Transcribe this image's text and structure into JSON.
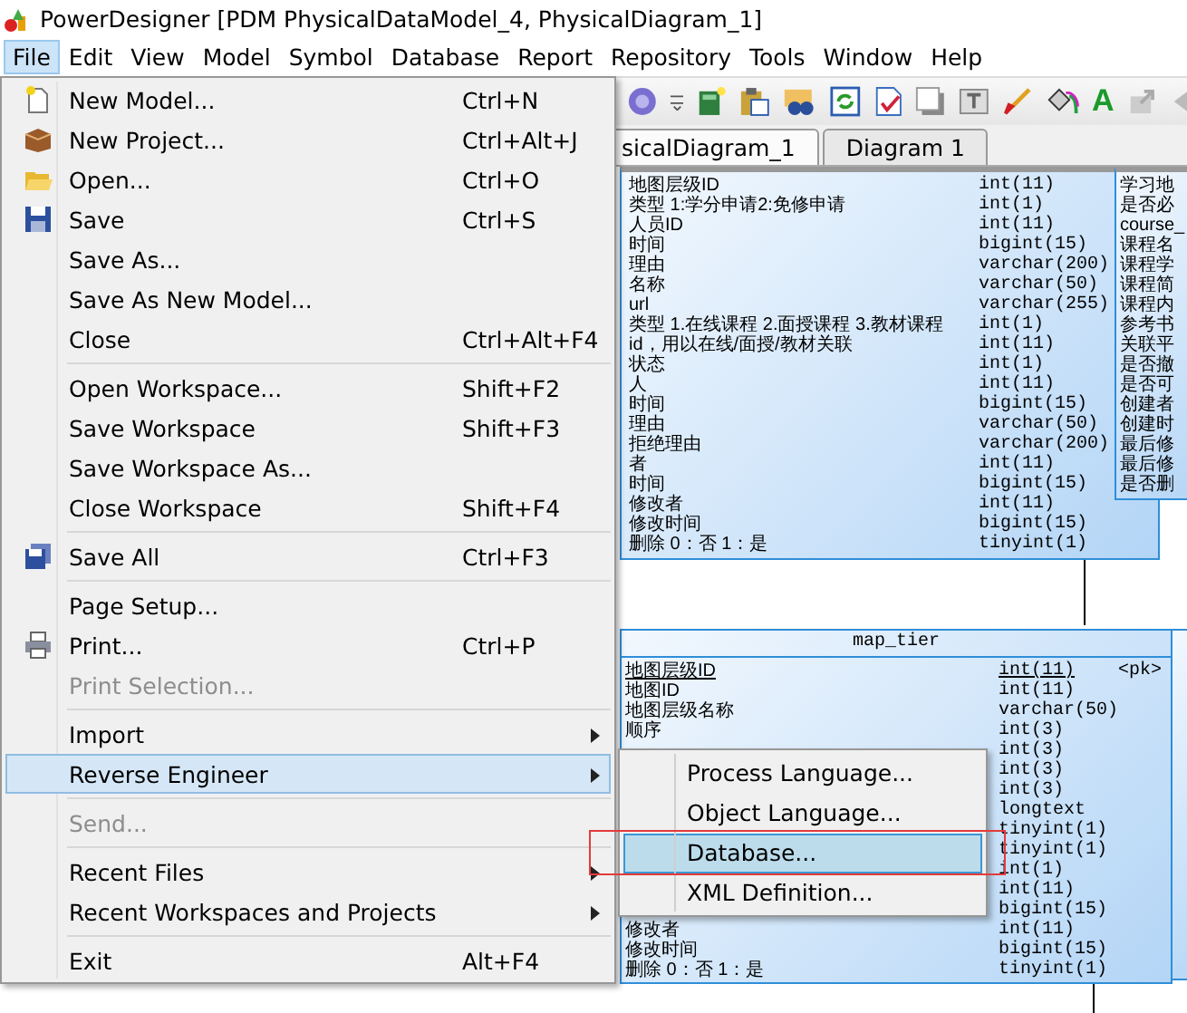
{
  "window": {
    "title": "PowerDesigner [PDM PhysicalDataModel_4, PhysicalDiagram_1]"
  },
  "menubar": [
    {
      "label": "File",
      "selected": true
    },
    {
      "label": "Edit",
      "selected": false
    },
    {
      "label": "View",
      "selected": false
    },
    {
      "label": "Model",
      "selected": false
    },
    {
      "label": "Symbol",
      "selected": false
    },
    {
      "label": "Database",
      "selected": false
    },
    {
      "label": "Report",
      "selected": false
    },
    {
      "label": "Repository",
      "selected": false
    },
    {
      "label": "Tools",
      "selected": false
    },
    {
      "label": "Window",
      "selected": false
    },
    {
      "label": "Help",
      "selected": false
    }
  ],
  "toolbar": {
    "glyph": "A"
  },
  "diagram_tabs": [
    {
      "label": "sicalDiagram_1",
      "selected": true
    },
    {
      "label": "Diagram 1",
      "selected": false
    }
  ],
  "upper_table": {
    "rows": [
      {
        "name": "地图层级ID",
        "type": "int(11)"
      },
      {
        "name": "类型 1:学分申请2:免修申请",
        "type": "int(1)"
      },
      {
        "name": "人员ID",
        "type": "int(11)"
      },
      {
        "name": "时间",
        "type": "bigint(15)"
      },
      {
        "name": "理由",
        "type": "varchar(200)"
      },
      {
        "name": "名称",
        "type": "varchar(50)"
      },
      {
        "name": "url",
        "type": "varchar(255)"
      },
      {
        "name": "类型 1.在线课程 2.面授课程 3.教材课程",
        "type": "int(1)"
      },
      {
        "name": "id，用以在线/面授/教材关联",
        "type": "int(11)"
      },
      {
        "name": "状态",
        "type": "int(1)"
      },
      {
        "name": "人",
        "type": "int(11)"
      },
      {
        "name": "时间",
        "type": "bigint(15)"
      },
      {
        "name": "理由",
        "type": "varchar(50)"
      },
      {
        "name": "拒绝理由",
        "type": "varchar(200)"
      },
      {
        "name": "者",
        "type": "int(11)"
      },
      {
        "name": "时间",
        "type": "bigint(15)"
      },
      {
        "name": "修改者",
        "type": "int(11)"
      },
      {
        "name": "修改时间",
        "type": "bigint(15)"
      },
      {
        "name": "删除 0：否 1：是",
        "type": "tinyint(1)"
      }
    ]
  },
  "side_table": {
    "rows": [
      "学习地",
      "是否必",
      "course_",
      "课程名",
      "课程学",
      "课程简",
      "课程内",
      "参考书",
      "关联平",
      "是否撤",
      "是否可",
      "创建者",
      "创建时",
      "最后修",
      "最后修",
      "是否删"
    ]
  },
  "map_tier_table": {
    "title": "map_tier",
    "rows": [
      {
        "name": "地图层级ID",
        "type": "int(11)",
        "key": "<pk>"
      },
      {
        "name": "地图ID",
        "type": "int(11)"
      },
      {
        "name": "地图层级名称",
        "type": "varchar(50)"
      },
      {
        "name": "顺序",
        "type": "int(3)"
      },
      {
        "type": "int(3)"
      },
      {
        "type": "int(3)"
      },
      {
        "type": "int(3)"
      },
      {
        "type": "longtext"
      },
      {
        "type": "tinyint(1)"
      },
      {
        "type": "tinyint(1)"
      },
      {
        "type": "int(1)"
      },
      {
        "type": "int(11)"
      },
      {
        "type": "bigint(15)"
      },
      {
        "name": "修改者",
        "type": "int(11)"
      },
      {
        "name": "修改时间",
        "type": "bigint(15)"
      },
      {
        "name": "删除 0：否 1：是",
        "type": "tinyint(1)"
      }
    ]
  },
  "file_menu": {
    "items": [
      {
        "kind": "item",
        "label": "New Model...",
        "shortcut": "Ctrl+N",
        "submenu": false,
        "disabled": false,
        "selected": false
      },
      {
        "kind": "item",
        "label": "New Project...",
        "shortcut": "Ctrl+Alt+J",
        "submenu": false,
        "disabled": false,
        "selected": false
      },
      {
        "kind": "item",
        "label": "Open...",
        "shortcut": "Ctrl+O",
        "submenu": false,
        "disabled": false,
        "selected": false
      },
      {
        "kind": "item",
        "label": "Save",
        "shortcut": "Ctrl+S",
        "submenu": false,
        "disabled": false,
        "selected": false
      },
      {
        "kind": "item",
        "label": "Save As...",
        "submenu": false,
        "disabled": false,
        "selected": false
      },
      {
        "kind": "item",
        "label": "Save As New Model...",
        "submenu": false,
        "disabled": false,
        "selected": false
      },
      {
        "kind": "item",
        "label": "Close",
        "shortcut": "Ctrl+Alt+F4",
        "submenu": false,
        "disabled": false,
        "selected": false
      },
      {
        "kind": "separator"
      },
      {
        "kind": "item",
        "label": "Open Workspace...",
        "shortcut": "Shift+F2",
        "submenu": false,
        "disabled": false,
        "selected": false
      },
      {
        "kind": "item",
        "label": "Save Workspace",
        "shortcut": "Shift+F3",
        "submenu": false,
        "disabled": false,
        "selected": false
      },
      {
        "kind": "item",
        "label": "Save Workspace As...",
        "submenu": false,
        "disabled": false,
        "selected": false
      },
      {
        "kind": "item",
        "label": "Close Workspace",
        "shortcut": "Shift+F4",
        "submenu": false,
        "disabled": false,
        "selected": false
      },
      {
        "kind": "separator"
      },
      {
        "kind": "item",
        "label": "Save All",
        "shortcut": "Ctrl+F3",
        "submenu": false,
        "disabled": false,
        "selected": false
      },
      {
        "kind": "separator"
      },
      {
        "kind": "item",
        "label": "Page Setup...",
        "submenu": false,
        "disabled": false,
        "selected": false
      },
      {
        "kind": "item",
        "label": "Print...",
        "shortcut": "Ctrl+P",
        "submenu": false,
        "disabled": false,
        "selected": false
      },
      {
        "kind": "item",
        "label": "Print Selection...",
        "submenu": false,
        "disabled": true,
        "selected": false
      },
      {
        "kind": "separator"
      },
      {
        "kind": "item",
        "label": "Import",
        "submenu": true,
        "disabled": false,
        "selected": false
      },
      {
        "kind": "item",
        "label": "Reverse Engineer",
        "submenu": true,
        "disabled": false,
        "selected": true
      },
      {
        "kind": "separator"
      },
      {
        "kind": "item",
        "label": "Send...",
        "submenu": false,
        "disabled": true,
        "selected": false
      },
      {
        "kind": "separator"
      },
      {
        "kind": "item",
        "label": "Recent Files",
        "submenu": true,
        "disabled": false,
        "selected": false
      },
      {
        "kind": "item",
        "label": "Recent Workspaces and Projects",
        "submenu": true,
        "disabled": false,
        "selected": false
      },
      {
        "kind": "separator"
      },
      {
        "kind": "item",
        "label": "Exit",
        "shortcut": "Alt+F4",
        "submenu": false,
        "disabled": false,
        "selected": false
      }
    ]
  },
  "reverse_engineer_submenu": {
    "items": [
      {
        "label": "Process Language...",
        "selected": false
      },
      {
        "label": "Object Language...",
        "selected": false
      },
      {
        "label": "Database...",
        "selected": true
      },
      {
        "label": "XML Definition...",
        "selected": false
      }
    ]
  }
}
